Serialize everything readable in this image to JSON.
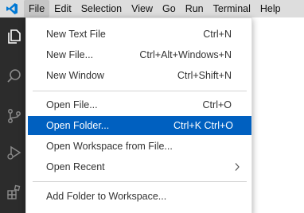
{
  "menubar": {
    "items": [
      "File",
      "Edit",
      "Selection",
      "View",
      "Go",
      "Run",
      "Terminal",
      "Help"
    ],
    "active": "File"
  },
  "file_menu": {
    "items": [
      {
        "label": "New Text File",
        "shortcut": "Ctrl+N"
      },
      {
        "label": "New File...",
        "shortcut": "Ctrl+Alt+Windows+N"
      },
      {
        "label": "New Window",
        "shortcut": "Ctrl+Shift+N"
      },
      {
        "label": "Open File...",
        "shortcut": "Ctrl+O"
      },
      {
        "label": "Open Folder...",
        "shortcut": "Ctrl+K Ctrl+O"
      },
      {
        "label": "Open Workspace from File...",
        "shortcut": ""
      },
      {
        "label": "Open Recent",
        "shortcut": ""
      },
      {
        "label": "Add Folder to Workspace...",
        "shortcut": ""
      }
    ],
    "highlighted": "Open Folder..."
  },
  "colors": {
    "accent": "#0060c0",
    "activitybar": "#2c2c2c",
    "titlebar": "#dddddd",
    "logo": "#0078d4"
  },
  "icons": [
    "vscode-logo-icon",
    "explorer-icon",
    "search-icon",
    "source-control-icon",
    "run-debug-icon",
    "extensions-icon",
    "chevron-right-icon"
  ]
}
